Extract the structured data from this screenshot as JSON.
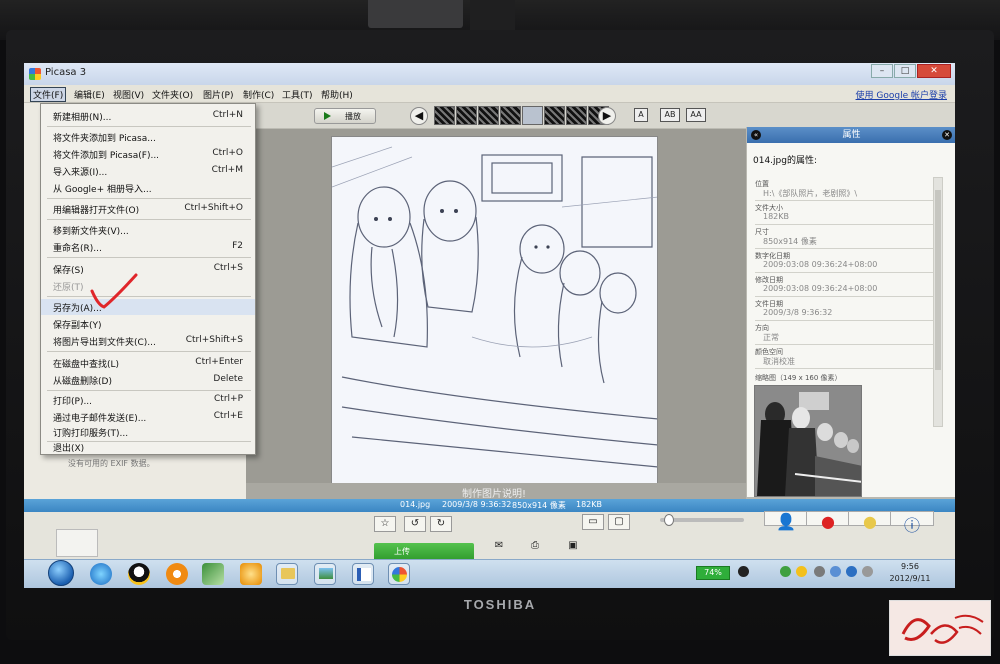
{
  "app": {
    "title": "Picasa 3"
  },
  "menubar": {
    "items": [
      {
        "label": "文件(F)"
      },
      {
        "label": "编辑(E)"
      },
      {
        "label": "视图(V)"
      },
      {
        "label": "文件夹(O)"
      },
      {
        "label": "图片(P)"
      },
      {
        "label": "制作(C)"
      },
      {
        "label": "工具(T)"
      },
      {
        "label": "帮助(H)"
      }
    ],
    "login": "使用 Google 帐户登录"
  },
  "toolbar": {
    "play": "播放",
    "font_buttons": [
      "A",
      "AB",
      "AA"
    ]
  },
  "file_menu": {
    "items": [
      {
        "label": "新建相册(N)...",
        "shortcut": "Ctrl+N"
      },
      {
        "label": "将文件夹添加到 Picasa...",
        "shortcut": ""
      },
      {
        "label": "将文件添加到 Picasa(F)...",
        "shortcut": "Ctrl+O"
      },
      {
        "label": "导入来源(I)...",
        "shortcut": "Ctrl+M"
      },
      {
        "label": "从 Google+ 相册导入...",
        "shortcut": ""
      },
      {
        "label": "用编辑器打开文件(O)",
        "shortcut": "Ctrl+Shift+O"
      },
      {
        "label": "移到新文件夹(V)...",
        "shortcut": ""
      },
      {
        "label": "重命名(R)...",
        "shortcut": "F2"
      },
      {
        "label": "保存(S)",
        "shortcut": "Ctrl+S"
      },
      {
        "label": "还原(T)",
        "shortcut": "",
        "disabled": true
      },
      {
        "label": "另存为(A)...",
        "shortcut": ""
      },
      {
        "label": "保存副本(Y)",
        "shortcut": ""
      },
      {
        "label": "将图片导出到文件夹(C)...",
        "shortcut": "Ctrl+Shift+S"
      },
      {
        "label": "在磁盘中查找(L)",
        "shortcut": "Ctrl+Enter"
      },
      {
        "label": "从磁盘删除(D)",
        "shortcut": "Delete"
      },
      {
        "label": "打印(P)...",
        "shortcut": "Ctrl+P"
      },
      {
        "label": "通过电子邮件发送(E)...",
        "shortcut": "Ctrl+E"
      },
      {
        "label": "订购打印服务(T)...",
        "shortcut": ""
      },
      {
        "label": "退出(X)",
        "shortcut": ""
      }
    ]
  },
  "left_panel": {
    "exif_note": "没有可用的 EXIF 数据。"
  },
  "photo": {
    "caption": "制作图片说明!"
  },
  "infobar": {
    "filename": "014.jpg",
    "date": "2009/3/8 9:36:32",
    "dimensions": "850x914 像素",
    "size": "182KB"
  },
  "properties": {
    "title": "属性",
    "file_heading": "014.jpg的属性:",
    "rows": [
      {
        "label": "位置",
        "value": "H:\\《部队照片，老剧照》\\"
      },
      {
        "label": "文件大小",
        "value": "182KB"
      },
      {
        "label": "尺寸",
        "value": "850x914 像素"
      },
      {
        "label": "数字化日期",
        "value": "2009:03:08 09:36:24+08:00"
      },
      {
        "label": "修改日期",
        "value": "2009:03:08 09:36:24+08:00"
      },
      {
        "label": "文件日期",
        "value": "2009/3/8 9:36:32"
      },
      {
        "label": "方向",
        "value": "正常"
      },
      {
        "label": "颜色空间",
        "value": "取消校准"
      }
    ],
    "thumbnail_label": "缩略图（149 x 160 像素）"
  },
  "tray": {
    "upload": "上传"
  },
  "taskbar": {
    "battery": "74%",
    "time": "9:56",
    "date": "2012/9/11"
  },
  "monitor": {
    "brand": "TOSHIBA"
  },
  "colors": {
    "accent": "#3b86c3",
    "upload_green": "#2e9a2b",
    "check_red": "#e0262a"
  }
}
